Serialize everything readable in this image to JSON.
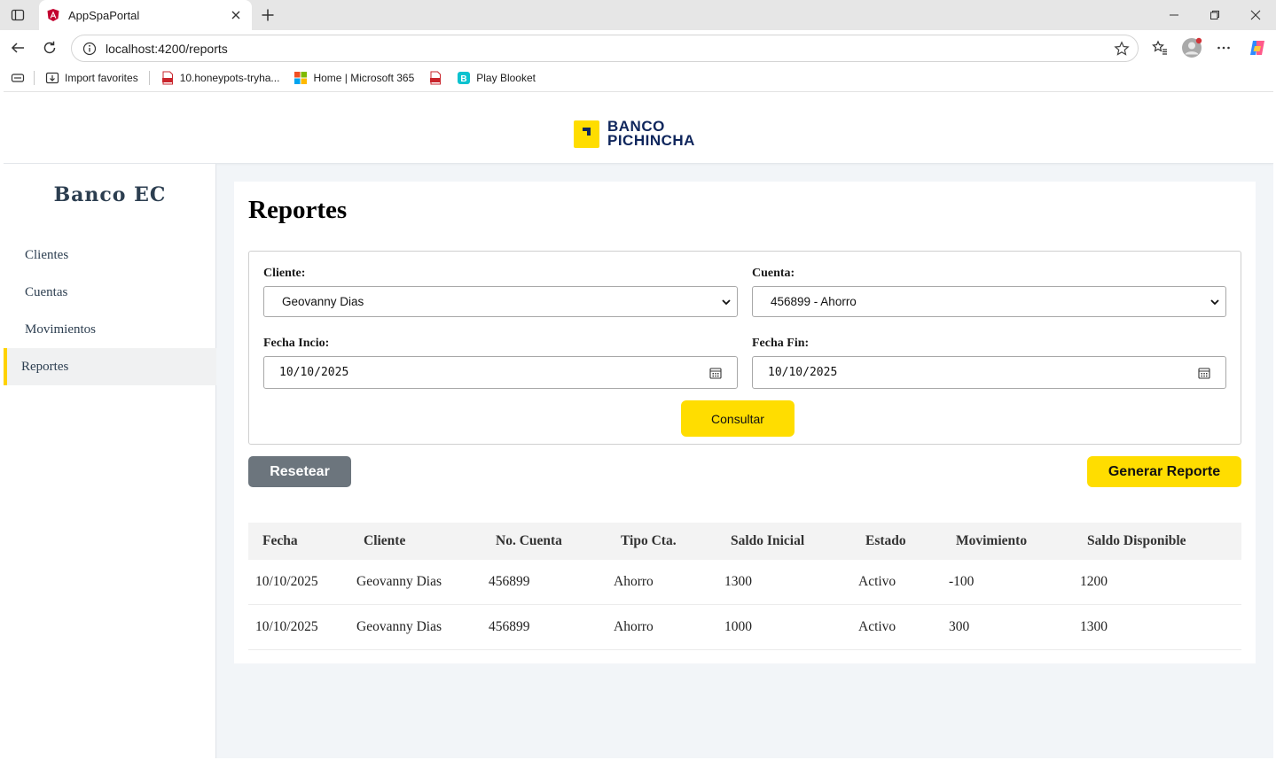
{
  "browser": {
    "tab_title": "AppSpaPortal",
    "url": "localhost:4200/reports",
    "bookmarks": [
      {
        "label": "Import favorites",
        "icon": "import-icon"
      },
      {
        "label": "10.honeypots-tryha...",
        "icon": "pdf-icon"
      },
      {
        "label": "Home | Microsoft 365",
        "icon": "microsoft-icon"
      },
      {
        "label": "",
        "icon": "pdf-icon"
      },
      {
        "label": "Play Blooket",
        "icon": "blooket-icon"
      }
    ]
  },
  "header": {
    "logo_line1": "BANCO",
    "logo_line2": "PICHINCHA",
    "brand_color": "#ffdd00",
    "logo_color": "#0f265c"
  },
  "sidebar": {
    "brand": "Banco EC",
    "items": [
      {
        "label": "Clientes",
        "active": false
      },
      {
        "label": "Cuentas",
        "active": false
      },
      {
        "label": "Movimientos",
        "active": false
      },
      {
        "label": "Reportes",
        "active": true
      }
    ],
    "accent": "#ffd200"
  },
  "main": {
    "title": "Reportes",
    "filters": {
      "cliente_label": "Cliente:",
      "cliente_value": "Geovanny Dias",
      "cuenta_label": "Cuenta:",
      "cuenta_value": "456899 - Ahorro",
      "fecha_inicio_label": "Fecha Incio:",
      "fecha_inicio_value": "10/10/2025",
      "fecha_fin_label": "Fecha Fin:",
      "fecha_fin_value": "10/10/2025",
      "consultar_label": "Consultar"
    },
    "reset_label": "Resetear",
    "generar_label": "Generar Reporte",
    "table": {
      "columns": [
        "Fecha",
        "Cliente",
        "No. Cuenta",
        "Tipo Cta.",
        "Saldo Inicial",
        "Estado",
        "Movimiento",
        "Saldo Disponible"
      ],
      "rows": [
        [
          "10/10/2025",
          "Geovanny Dias",
          "456899",
          "Ahorro",
          "1300",
          "Activo",
          "-100",
          "1200"
        ],
        [
          "10/10/2025",
          "Geovanny Dias",
          "456899",
          "Ahorro",
          "1000",
          "Activo",
          "300",
          "1300"
        ]
      ]
    }
  }
}
